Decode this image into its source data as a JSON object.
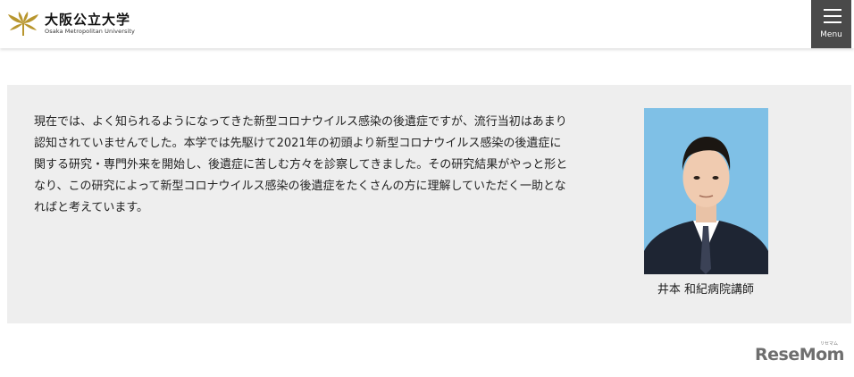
{
  "header": {
    "logo_jp": "大阪公立大学",
    "logo_en": "Osaka Metropolitan University",
    "menu_label": "Menu"
  },
  "content": {
    "paragraph": "現在では、よく知られるようになってきた新型コロナウイルス感染の後遺症ですが、流行当初はあまり認知されていませんでした。本学では先駆けて2021年の初頭より新型コロナウイルス感染の後遺症に関する研究・専門外来を開始し、後遺症に苦しむ方々を診察してきました。その研究結果がやっと形となり、この研究によって新型コロナウイルス感染の後遺症をたくさんの方に理解していただく一助となればと考えています。",
    "caption": "井本 和紀病院講師"
  },
  "watermark": {
    "text": "ReseMom",
    "small": "リセマム"
  },
  "colors": {
    "logo_gold": "#b8962e",
    "menu_bg": "#4a4a4a",
    "panel_bg": "#eeeeee",
    "photo_bg": "#7fc0e6"
  }
}
